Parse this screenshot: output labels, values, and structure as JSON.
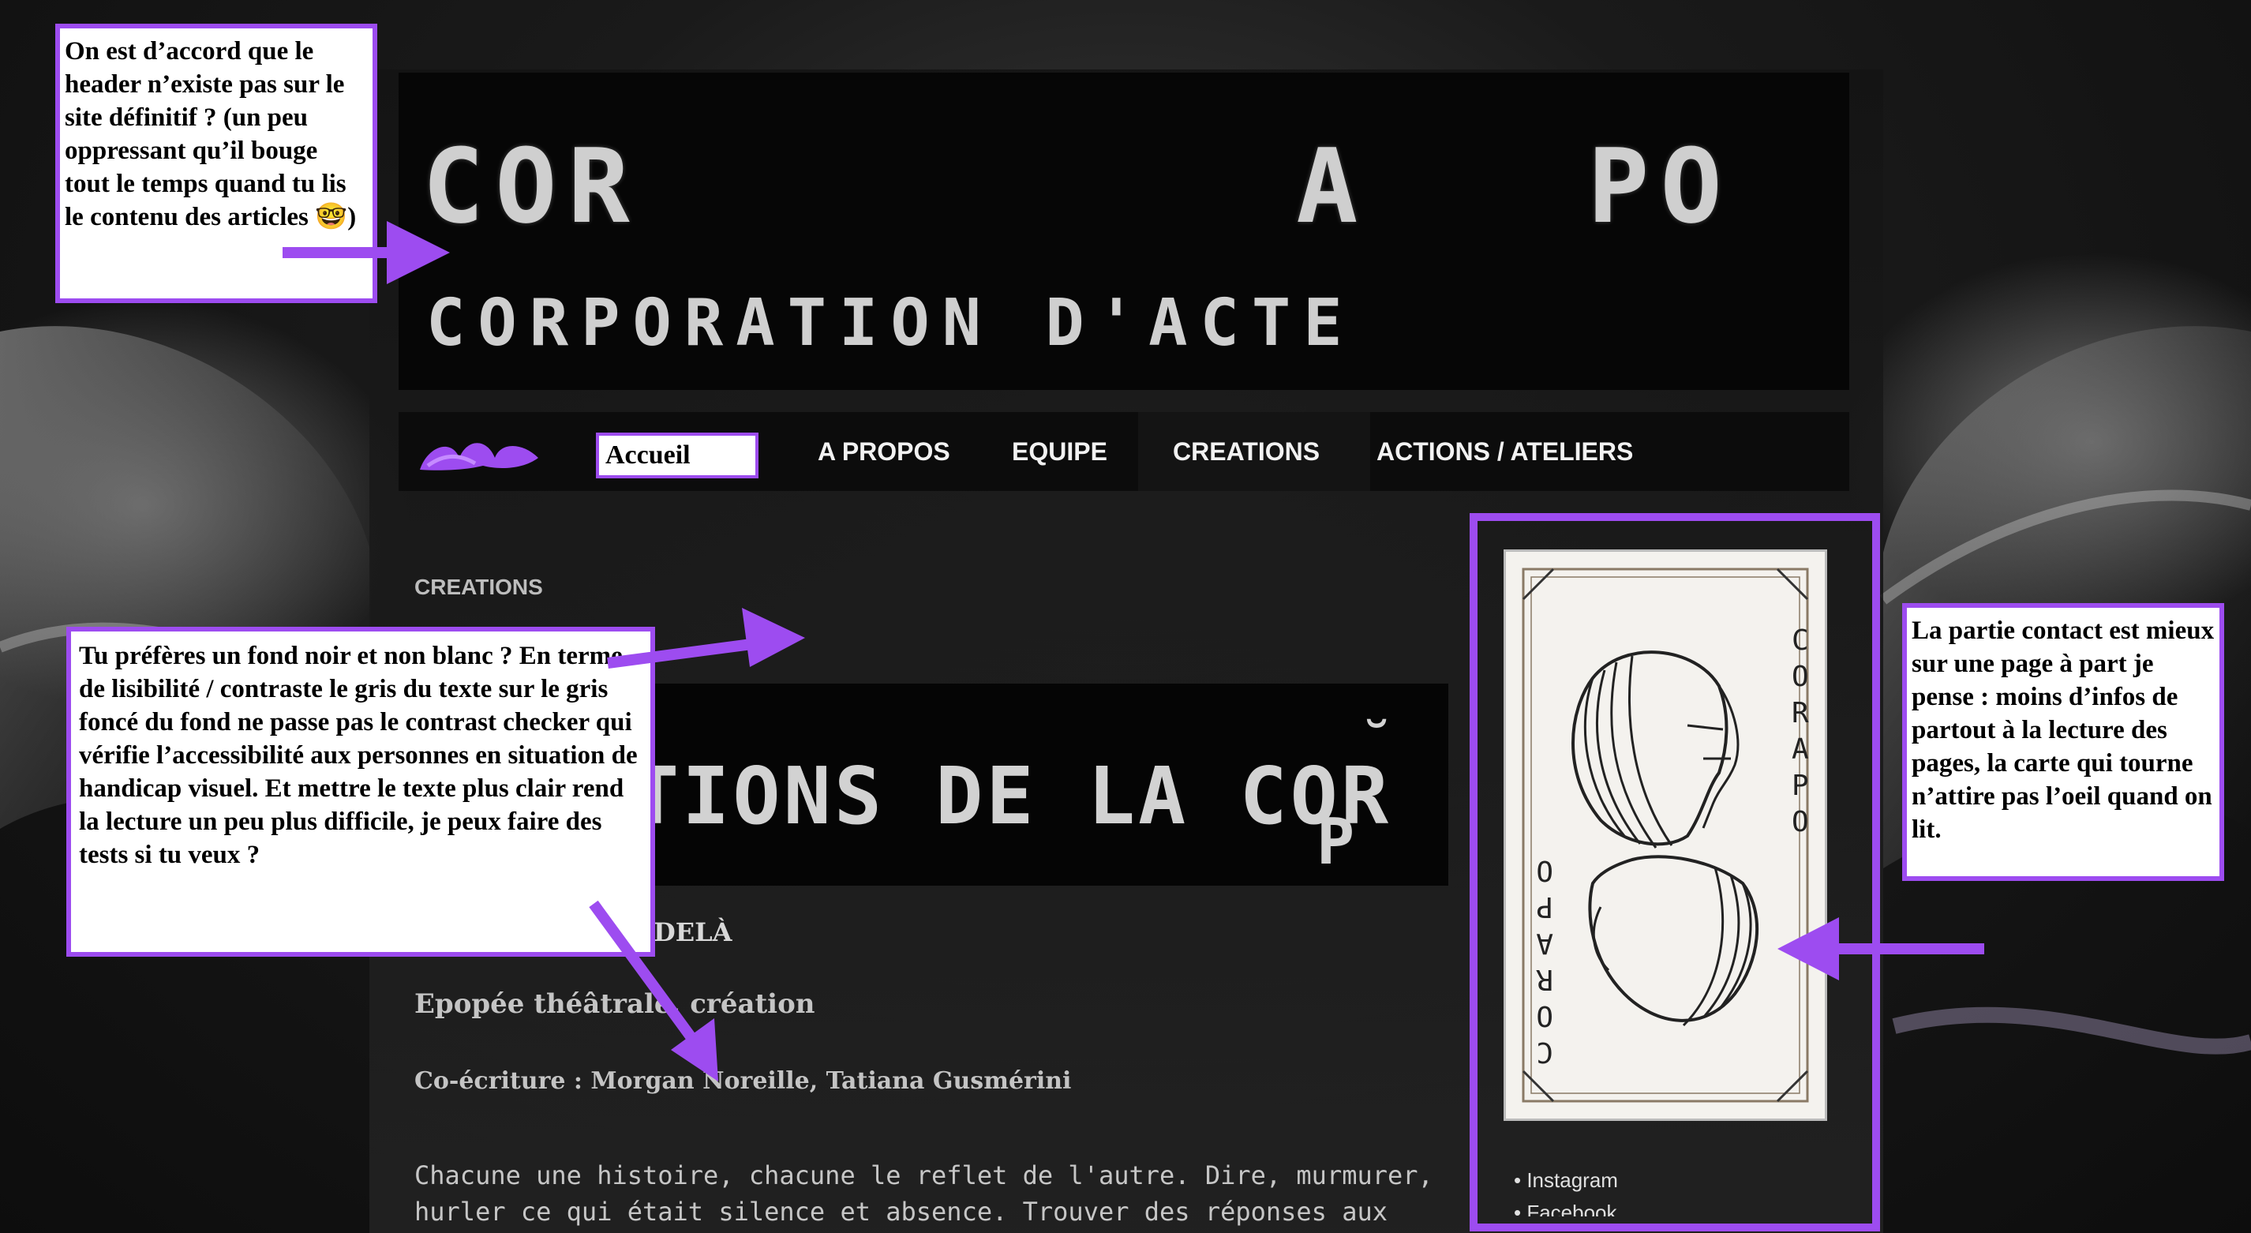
{
  "header": {
    "title": "COR         A   PO",
    "subtitle": "CORPORATION D'ACTE"
  },
  "nav": {
    "items": [
      {
        "label": "Accueil"
      },
      {
        "label": "A PROPOS"
      },
      {
        "label": "EQUIPE"
      },
      {
        "label": "CREATIONS"
      },
      {
        "label": "ACTIONS / ATELIERS"
      }
    ]
  },
  "breadcrumb": "CREATIONS",
  "page_title": "TIONS DE LA COR",
  "page_title_tail_top": "˘",
  "page_title_tail_bottom": "P",
  "article": {
    "heading_fragment": "DELÀ",
    "genre": "Epopée théâtrale, création",
    "credits": "Co-écriture : Morgan Noreille, Tatiana Gusmérini",
    "paragraph": "Chacune une histoire, chacune le reflet de l'autre. Dire, murmurer, hurler ce qui était silence et absence. Trouver des réponses aux"
  },
  "sidebar": {
    "card_text_right": "CORAPO",
    "card_text_left": "CORAPO",
    "social": [
      "Instagram",
      "Facebook"
    ]
  },
  "annotations": {
    "note_header": "On est d’accord que le header n’existe pas sur le site définitif ? (un peu oppressant qu’il bouge tout le temps quand tu lis le contenu des articles 🤓)",
    "note_background": "Tu préfères un fond noir et non blanc ? En terme de lisibilité / contraste le gris du texte sur le gris foncé du fond ne passe pas le contrast checker qui vérifie l’accessibilité aux personnes en situation de handicap visuel. Et mettre le texte plus clair rend la lecture un peu plus difficile, je peux faire des tests si tu veux ?",
    "note_contact": "La partie contact est mieux sur une page à part je pense : moins d’infos de partout à la lecture des pages, la carte qui tourne n’attire pas l’oeil quand on lit."
  },
  "colors": {
    "annotation_accent": "#9d4cf0",
    "page_bg": "#1a1a1a",
    "text_grey": "#c4c4c4"
  }
}
